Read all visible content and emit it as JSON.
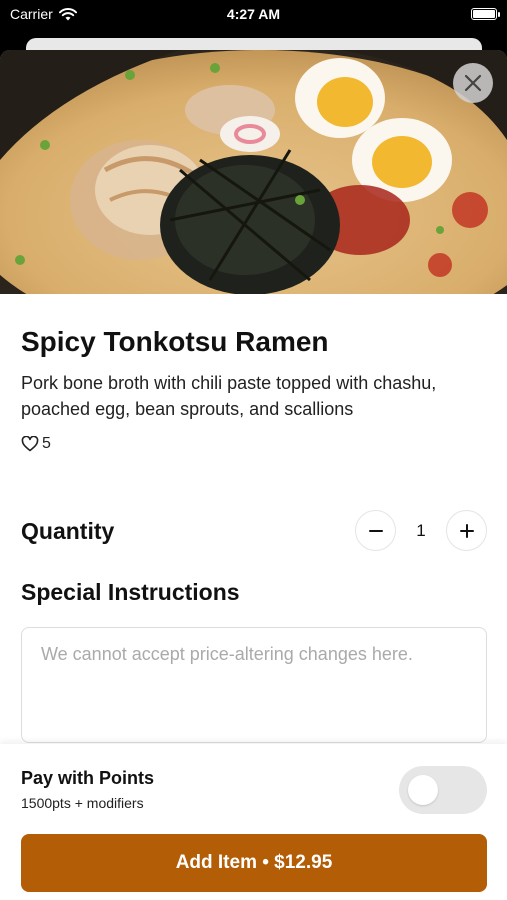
{
  "status_bar": {
    "carrier": "Carrier",
    "time": "4:27 AM"
  },
  "item": {
    "name": "Spicy Tonkotsu Ramen",
    "description": "Pork bone broth with chili paste topped with chashu, poached egg, bean sprouts, and scallions",
    "likes": "5"
  },
  "quantity": {
    "label": "Quantity",
    "value": "1"
  },
  "special_instructions": {
    "label": "Special Instructions",
    "value": "",
    "placeholder": "We cannot accept price-altering changes here."
  },
  "points": {
    "label": "Pay with Points",
    "subtext": "1500pts + modifiers",
    "enabled": false
  },
  "add_button": {
    "label": "Add Item • $12.95"
  },
  "icons": {
    "close": "close-icon",
    "heart": "heart-icon",
    "minus": "minus-icon",
    "plus": "plus-icon",
    "wifi": "wifi-icon",
    "battery": "battery-icon"
  },
  "colors": {
    "accent": "#b35d07",
    "toggle_off": "#e6e6e6",
    "border": "#dddddd"
  }
}
